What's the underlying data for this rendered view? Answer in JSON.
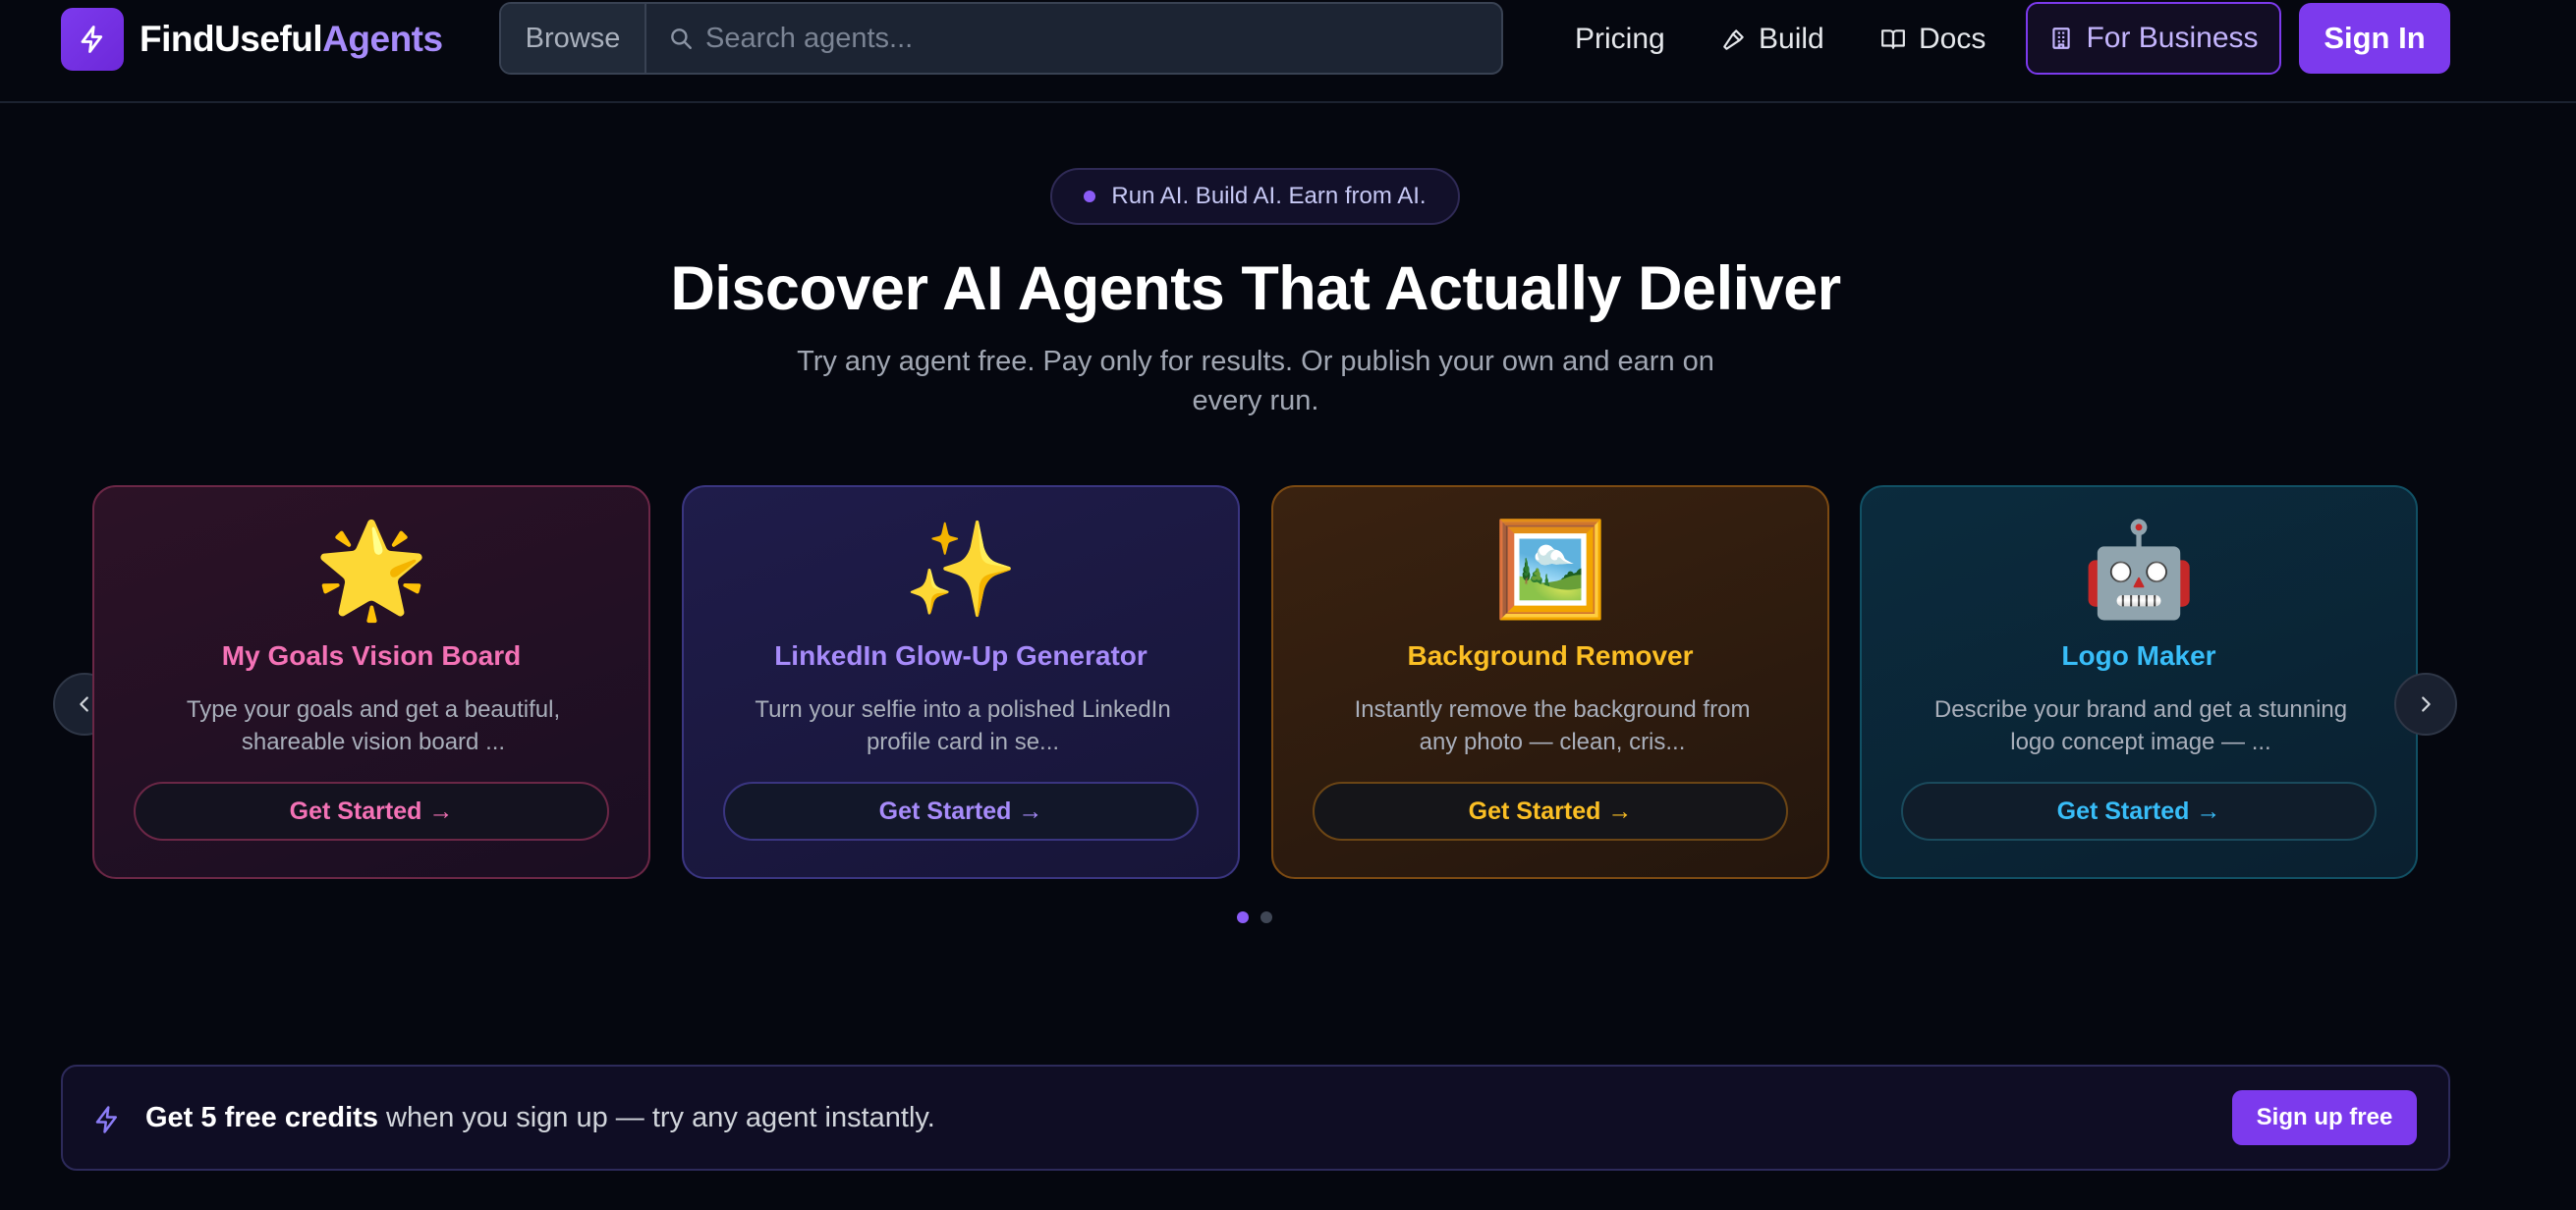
{
  "header": {
    "brand_primary": "FindUseful",
    "brand_accent": "Agents",
    "browse_label": "Browse",
    "search_placeholder": "Search agents...",
    "nav": {
      "pricing": "Pricing",
      "build": "Build",
      "docs": "Docs",
      "for_business": "For Business",
      "sign_in": "Sign In"
    }
  },
  "hero": {
    "badge": "Run AI. Build AI. Earn from AI.",
    "title": "Discover AI Agents That Actually Deliver",
    "subtitle": "Try any agent free. Pay only for results. Or publish your own and earn on every run."
  },
  "carousel": {
    "cards": [
      {
        "emoji": "🌟",
        "title": "My Goals Vision Board",
        "description": "Type your goals and get a beautiful, shareable vision board ...",
        "button": "Get Started →",
        "accent": "#f472b6"
      },
      {
        "emoji": "✨",
        "title": "LinkedIn Glow-Up Generator",
        "description": "Turn your selfie into a polished LinkedIn profile card in se...",
        "button": "Get Started →",
        "accent": "#a78bfa"
      },
      {
        "emoji": "🖼️",
        "title": "Background Remover",
        "description": "Instantly remove the background from any photo — clean, cris...",
        "button": "Get Started →",
        "accent": "#fbbf24"
      },
      {
        "emoji": "🤖",
        "title": "Logo Maker",
        "description": "Describe your brand and get a stunning logo concept image — ...",
        "button": "Get Started →",
        "accent": "#38bdf8"
      }
    ],
    "page_count": 2,
    "active_page": 1
  },
  "banner": {
    "bold": "Get 5 free credits",
    "rest": " when you sign up — try any agent instantly.",
    "button": "Sign up free"
  },
  "colors": {
    "brand": "#7c3aed",
    "background": "#05070f"
  },
  "icons": [
    "bolt-icon",
    "search-icon",
    "hammer-icon",
    "book-icon",
    "building-icon",
    "chevron-left-icon",
    "chevron-right-icon"
  ]
}
